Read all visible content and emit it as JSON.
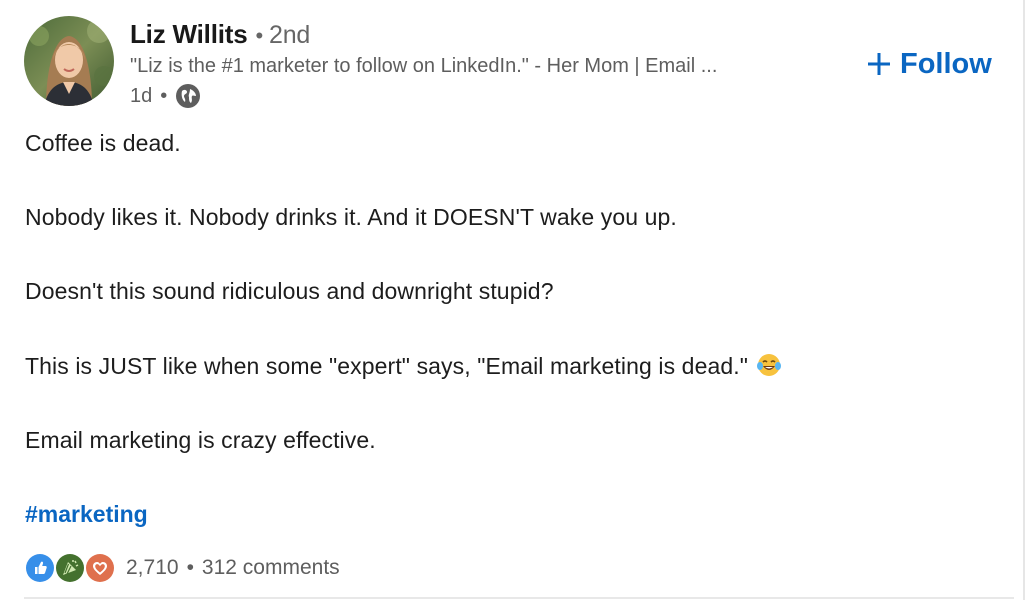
{
  "author": {
    "name": "Liz Willits",
    "connection": "2nd",
    "headline": "\"Liz is the #1 marketer to follow on LinkedIn.\" - Her Mom | Email ...",
    "time": "1d",
    "visibility_icon": "globe-icon"
  },
  "follow_button": {
    "label": "Follow",
    "icon": "plus-icon",
    "color": "#0a66c2"
  },
  "post": {
    "paragraphs": [
      "Coffee is dead.",
      "Nobody likes it. Nobody drinks it. And it DOESN'T wake you up.",
      "Doesn't this sound ridiculous and downright stupid?",
      "This is JUST like when some \"expert\" says, \"Email marketing is dead.\"",
      "Email marketing is crazy effective."
    ],
    "emoji": "face-with-tears-of-joy",
    "hashtag": "#marketing"
  },
  "social": {
    "reactions": [
      "like-icon",
      "celebrate-icon",
      "love-icon"
    ],
    "reaction_count": "2,710",
    "separator": "•",
    "comments": "312 comments"
  },
  "colors": {
    "link": "#0a66c2",
    "muted": "#5e5e5e",
    "text": "#1d1d1d"
  }
}
